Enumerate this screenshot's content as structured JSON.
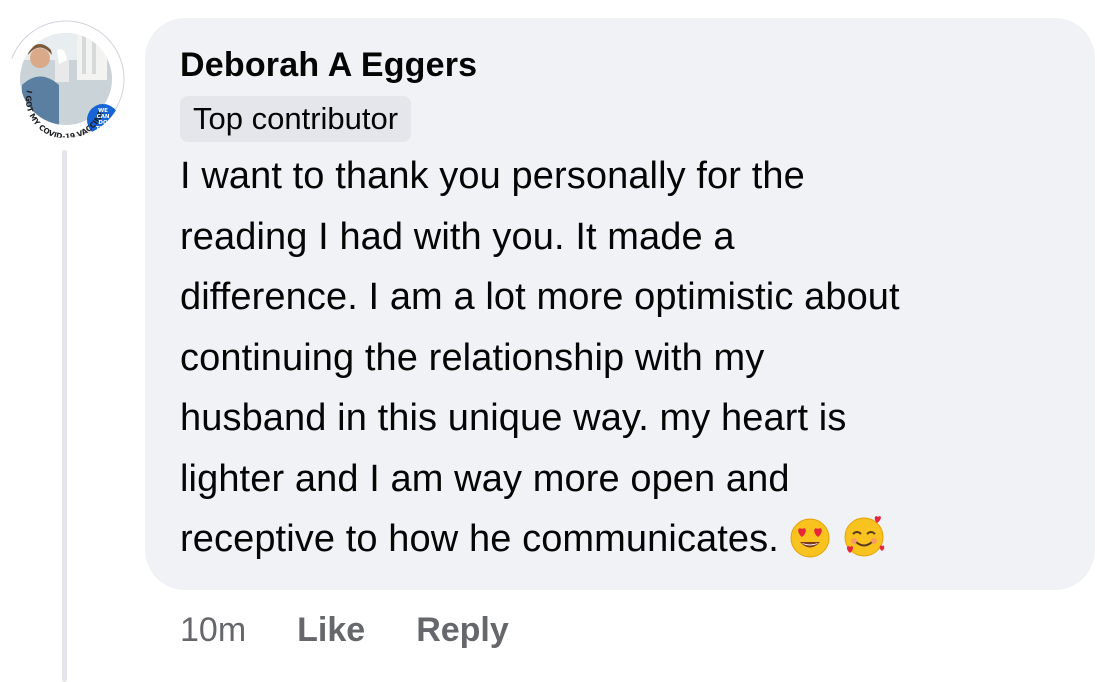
{
  "comment": {
    "author": "Deborah A Eggers",
    "badge": "Top contributor",
    "text_lines": [
      "I want to thank you personally for the",
      "reading I had with you. It made a",
      "difference. I am a lot more optimistic about",
      "continuing the relationship with my",
      "husband in this unique way. my heart is",
      "lighter and I am way more open and",
      "receptive to how he communicates."
    ],
    "emojis": [
      "heart-eyes-emoji",
      "smiling-face-with-hearts-emoji"
    ],
    "timestamp": "10m",
    "like_label": "Like",
    "reply_label": "Reply"
  },
  "avatar": {
    "frame_text": "I GOT MY COVID-19 VACCINE",
    "badge_text": [
      "WE",
      "CAN",
      "DO",
      "THIS"
    ]
  },
  "colors": {
    "bubble": "#f0f2f5",
    "badge_bg": "#e4e6eb",
    "text": "#050505",
    "secondary": "#65676b",
    "frame_blue": "#1664d6"
  }
}
